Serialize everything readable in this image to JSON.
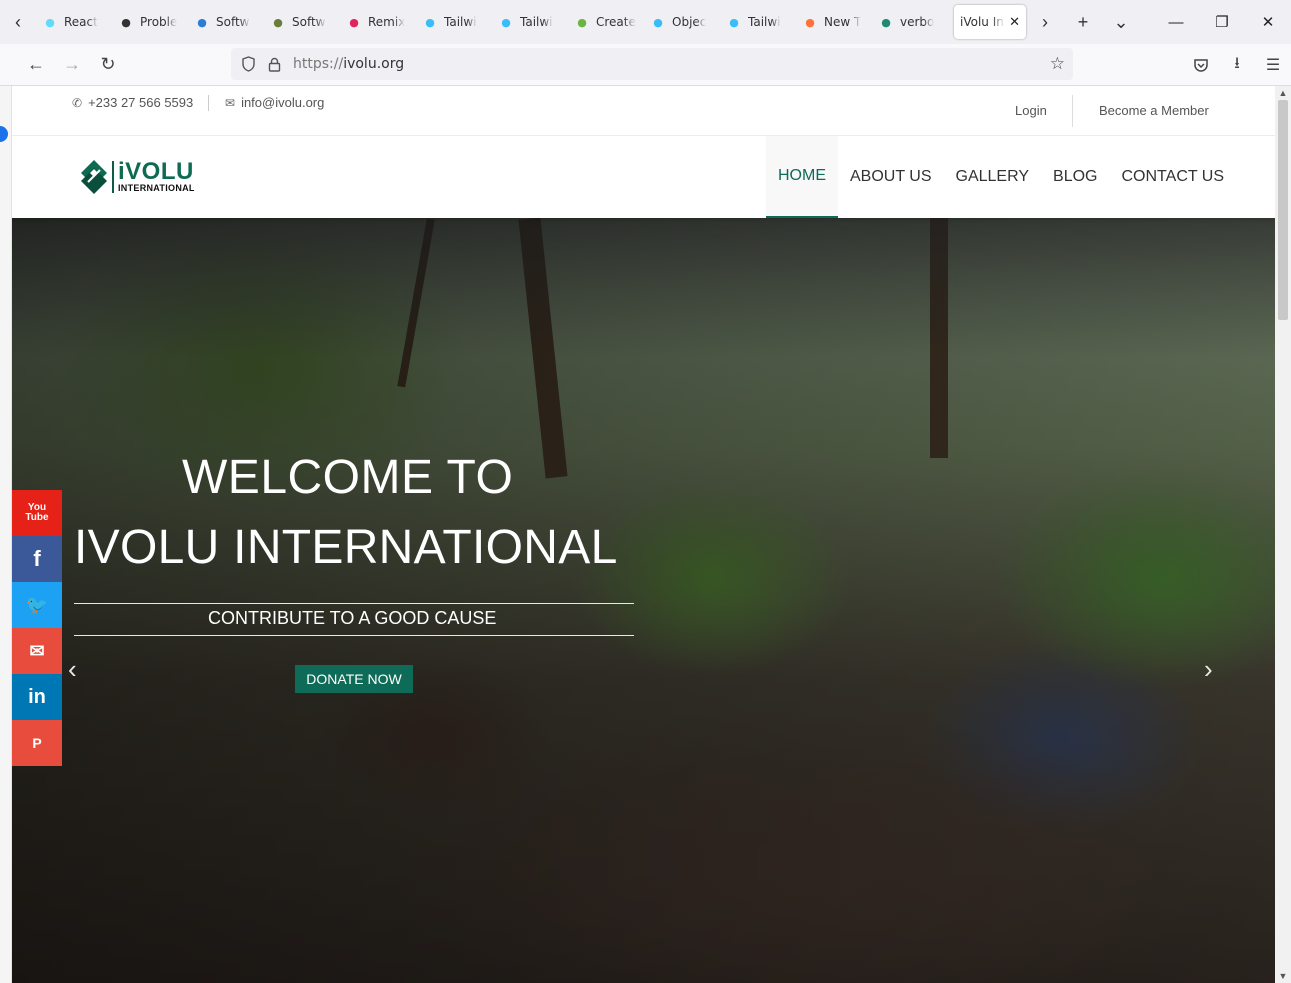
{
  "browser": {
    "tabs": [
      {
        "label": "React",
        "icon": "react-tab-icon",
        "color": "#61dafb"
      },
      {
        "label": "Proble",
        "icon": "info-tab-icon",
        "color": "#333333"
      },
      {
        "label": "Softw",
        "icon": "n-tab-icon",
        "color": "#2b7bd8"
      },
      {
        "label": "Softw",
        "icon": "bulb-tab-icon",
        "color": "#6b7d3a"
      },
      {
        "label": "Remix",
        "icon": "remix-tab-icon",
        "color": "#e0245e"
      },
      {
        "label": "Tailwi",
        "icon": "tailwind-tab-icon",
        "color": "#38bdf8"
      },
      {
        "label": "Tailwi",
        "icon": "tailwind-tab-icon",
        "color": "#38bdf8"
      },
      {
        "label": "Create",
        "icon": "leaf-tab-icon",
        "color": "#6db33f"
      },
      {
        "label": "Objec",
        "icon": "tailwind-tab-icon",
        "color": "#38bdf8"
      },
      {
        "label": "Tailwi",
        "icon": "tailwind-tab-icon",
        "color": "#38bdf8"
      },
      {
        "label": "New T",
        "icon": "firefox-tab-icon",
        "color": "#ff7139"
      },
      {
        "label": "verbo",
        "icon": "v-tab-icon",
        "color": "#1f8a70"
      }
    ],
    "active_tab": {
      "label": "iVolu Int",
      "close": "✕"
    },
    "url_scheme": "https://",
    "url_host": "ivolu.org"
  },
  "topbar": {
    "phone": "+233 27 566 5593",
    "email": "info@ivolu.org",
    "login": "Login",
    "member": "Become a Member"
  },
  "logo": {
    "big": "iVOLU",
    "small": "INTERNATIONAL",
    "color": "#0d6b52"
  },
  "menu": [
    {
      "label": "HOME",
      "active": true
    },
    {
      "label": "ABOUT US"
    },
    {
      "label": "GALLERY"
    },
    {
      "label": "BLOG"
    },
    {
      "label": "CONTACT US"
    }
  ],
  "hero": {
    "title1": "WELCOME TO",
    "title2": "IVOLU INTERNATIONAL",
    "subtitle": "CONTRIBUTE TO A GOOD CAUSE",
    "donate": "DONATE NOW",
    "prev": "‹",
    "next": "›"
  },
  "social": [
    {
      "name": "youtube",
      "label": "You Tube",
      "color": "#e62117"
    },
    {
      "name": "facebook",
      "label": "f",
      "color": "#3b5998"
    },
    {
      "name": "twitter",
      "label": "🐦",
      "color": "#1da1f2"
    },
    {
      "name": "email",
      "label": "✉",
      "color": "#e74c3c"
    },
    {
      "name": "linkedin",
      "label": "in",
      "color": "#0077b5"
    },
    {
      "name": "pinterest",
      "label": "P",
      "color": "#e74c3c"
    }
  ],
  "accent": "#0e6b57"
}
